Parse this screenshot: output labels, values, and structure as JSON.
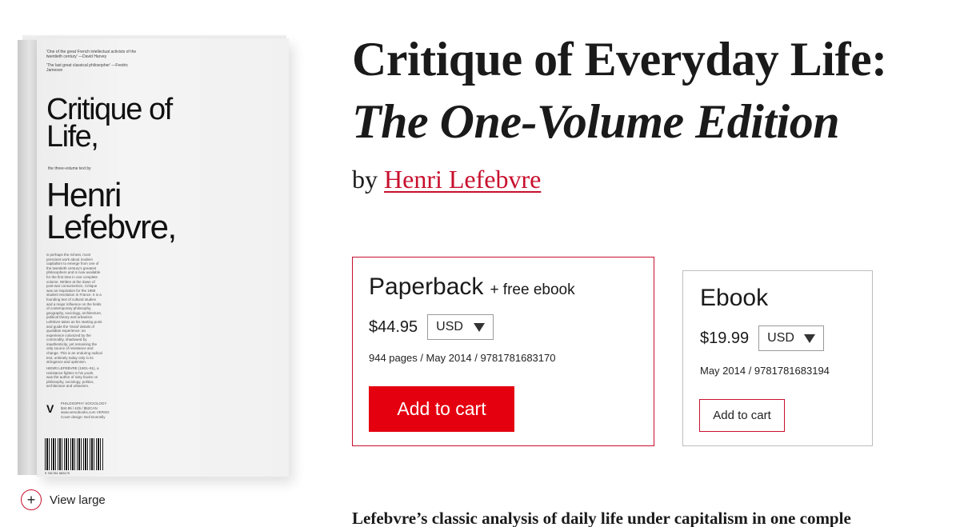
{
  "cover": {
    "blurb_1": "'One of the great French intellectual activists of the twentieth century' —David Harvey",
    "blurb_2": "'The last great classical philosopher' —Fredric Jameson",
    "title": "Critique of Life,",
    "subtitle": "the three-volume text by",
    "author": "Henri Lefebvre,",
    "body": "is perhaps the richest, most prescient work about modern capitalism to emerge from one of the twentieth century's greatest philosophers and is now available for the first time in one complete volume. Written at the dawn of post-war consumerism, Critique was an inspiration for the 1968 student revolution in France. It is a founding text of cultural studies and a major influence on the fields of contemporary philosophy, geography, sociology, architecture, political theory and urbanism. Lefebvre takes as his starting point and guide the 'trivial' details of quotidian experience: an experience colonized by the commodity, shadowed by inauthenticity, yet remaining the only source of resistance and change. This is an enduring radical text, untimely today only in its stringence and optimism.",
    "bio": "HENRI LEFEBVRE (1901–91), a resistance fighter in his youth, was the author of sixty books on philosophy, sociology, politics, architecture and urbanism.",
    "logo": "V",
    "publisher": "PHILOSOPHY SOCIOLOGY $44.95 / £25 / $52CAN www.versobooks.com VERSO Cover design: Neil Donnelly",
    "barcode_number": "9 781781 683170"
  },
  "view_large": {
    "icon": "plus-circle-icon",
    "label": "View large"
  },
  "book": {
    "title_line1": "Critique of Everyday Life:",
    "title_line2": "The One-Volume Edition",
    "by": "by",
    "author": "Henri Lefebvre"
  },
  "formats": {
    "paperback": {
      "name": "Paperback",
      "extra": "+ free ebook",
      "price": "$44.95",
      "currency": "USD",
      "meta": "944 pages / May 2014 / 9781781683170",
      "add_label": "Add to cart"
    },
    "ebook": {
      "name": "Ebook",
      "price": "$19.99",
      "currency": "USD",
      "meta": "May 2014 / 9781781683194",
      "add_label": "Add to cart"
    }
  },
  "tagline": "Lefebvre’s classic analysis of daily life under capitalism in one comple",
  "colors": {
    "accent": "#c8102e",
    "button_red": "#e4000f",
    "border_gray": "#bdbdbd"
  }
}
